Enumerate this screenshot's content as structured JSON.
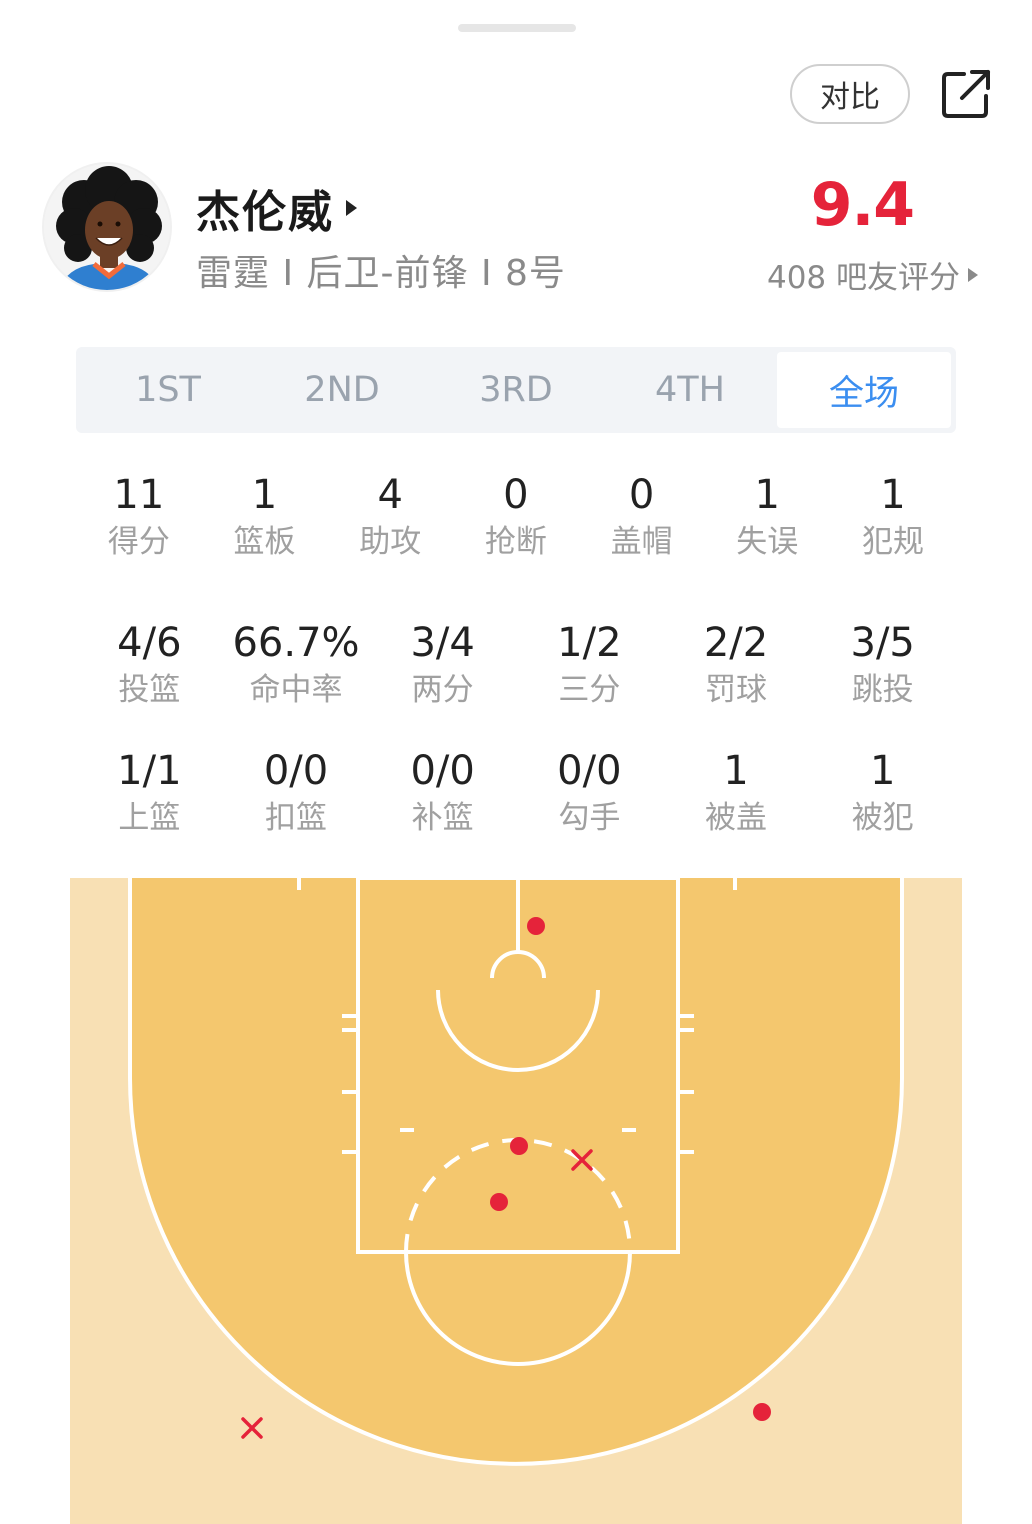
{
  "header": {
    "compare_label": "对比",
    "share_icon": "share-icon"
  },
  "player": {
    "name": "杰伦威",
    "team": "雷霆",
    "position": "后卫-前锋",
    "number": "8号",
    "info_line": "雷霆 I 后卫-前锋 I 8号"
  },
  "rating": {
    "score": "9.4",
    "count_text": "408 吧友评分"
  },
  "tabs": [
    {
      "label": "1ST",
      "active": false
    },
    {
      "label": "2ND",
      "active": false
    },
    {
      "label": "3RD",
      "active": false
    },
    {
      "label": "4TH",
      "active": false
    },
    {
      "label": "全场",
      "active": true
    }
  ],
  "basic_stats": [
    {
      "value": "11",
      "label": "得分"
    },
    {
      "value": "1",
      "label": "篮板"
    },
    {
      "value": "4",
      "label": "助攻"
    },
    {
      "value": "0",
      "label": "抢断"
    },
    {
      "value": "0",
      "label": "盖帽"
    },
    {
      "value": "1",
      "label": "失误"
    },
    {
      "value": "1",
      "label": "犯规"
    }
  ],
  "shooting_stats": [
    {
      "value": "4/6",
      "label": "投篮"
    },
    {
      "value": "66.7%",
      "label": "命中率"
    },
    {
      "value": "3/4",
      "label": "两分"
    },
    {
      "value": "1/2",
      "label": "三分"
    },
    {
      "value": "2/2",
      "label": "罚球"
    },
    {
      "value": "3/5",
      "label": "跳投"
    }
  ],
  "shot_type_stats": [
    {
      "value": "1/1",
      "label": "上篮"
    },
    {
      "value": "0/0",
      "label": "扣篮"
    },
    {
      "value": "0/0",
      "label": "补篮"
    },
    {
      "value": "0/0",
      "label": "勾手"
    },
    {
      "value": "1",
      "label": "被盖"
    },
    {
      "value": "1",
      "label": "被犯"
    }
  ],
  "colors": {
    "accent_blue": "#3b8ef0",
    "rating_red": "#e5233a",
    "court_inner": "#f4c76e",
    "court_outer": "#f8e0b4",
    "shot_made": "#e5233a",
    "shot_missed": "#e5233a"
  },
  "shot_chart": {
    "made_marker": "filled-dot",
    "missed_marker": "x-mark",
    "shots": [
      {
        "result": "made",
        "zone": "restricted-area"
      },
      {
        "result": "made",
        "zone": "free-throw-line"
      },
      {
        "result": "missed",
        "zone": "elbow-right"
      },
      {
        "result": "made",
        "zone": "top-of-key"
      },
      {
        "result": "missed",
        "zone": "left-wing-three"
      },
      {
        "result": "made",
        "zone": "right-wing-three"
      }
    ]
  }
}
